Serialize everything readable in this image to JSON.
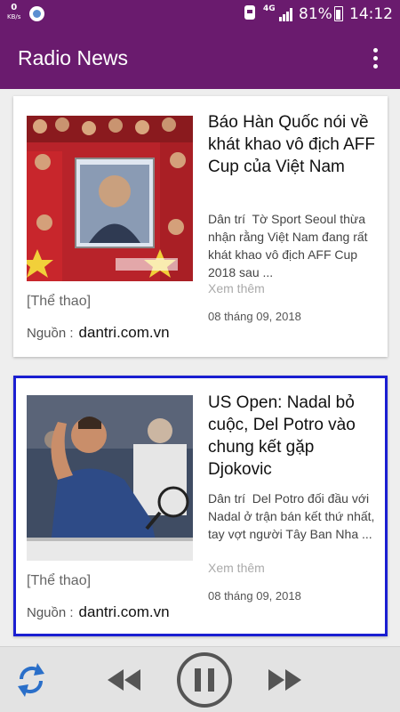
{
  "status_bar": {
    "net_speed": "0",
    "net_unit": "KB/s",
    "network_type": "4G",
    "battery_percent": "81%",
    "time": "14:12"
  },
  "app_bar": {
    "title": "Radio News",
    "menu_icon": "overflow-menu-icon"
  },
  "articles": [
    {
      "title": "Báo Hàn Quốc nói về khát khao vô địch AFF Cup của Việt Nam",
      "description": "Dân trí  Tờ Sport Seoul thừa nhận rằng Việt Nam đang rất khát khao vô địch AFF Cup 2018 sau ...",
      "more_label": "Xem thêm",
      "date": "08 tháng 09, 2018",
      "category": "[Thể thao]",
      "source_label": "Nguồn :",
      "source": "dantri.com.vn",
      "selected": false
    },
    {
      "title": "US Open: Nadal bỏ cuộc, Del Potro vào chung kết gặp Djokovic",
      "description": "Dân trí  Del Potro đối đầu với Nadal ở trận bán kết thứ nhất, tay vợt người Tây Ban Nha ...",
      "more_label": "Xem thêm",
      "date": "08 tháng 09, 2018",
      "category": "[Thể thao]",
      "source_label": "Nguồn :",
      "source": "dantri.com.vn",
      "selected": true
    }
  ],
  "player": {
    "controls": [
      "refresh-icon",
      "rewind-icon",
      "pause-icon",
      "fast-forward-icon"
    ],
    "refresh_color": "#2a6fc9",
    "control_color": "#555555"
  },
  "colors": {
    "primary": "#6a1b6e",
    "selected_border": "#1a1ed1"
  }
}
